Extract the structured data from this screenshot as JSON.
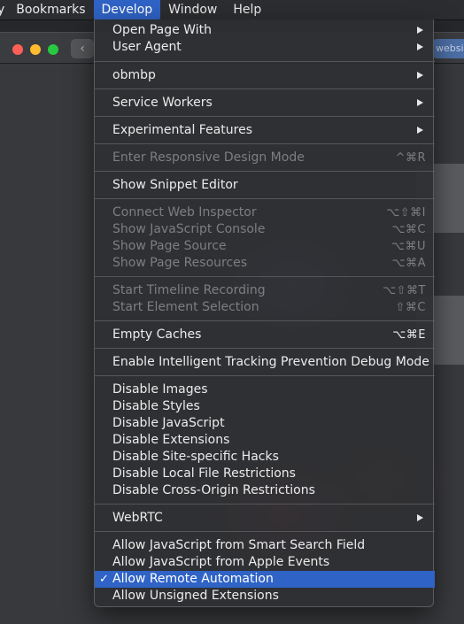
{
  "menubar": {
    "items": [
      "y",
      "Bookmarks",
      "Develop",
      "Window",
      "Help"
    ]
  },
  "window": {
    "back_icon": "chevron-left-icon",
    "url_peek": "websi"
  },
  "menu": {
    "items": [
      {
        "label": "Open Page With",
        "submenu": true
      },
      {
        "label": "User Agent",
        "submenu": true
      },
      {
        "label": "obmbp",
        "submenu": true
      },
      {
        "label": "Service Workers",
        "submenu": true
      },
      {
        "label": "Experimental Features",
        "submenu": true
      },
      {
        "label": "Enter Responsive Design Mode",
        "shortcut": "^⌘R",
        "disabled": true
      },
      {
        "label": "Show Snippet Editor"
      },
      {
        "label": "Connect Web Inspector",
        "shortcut": "⌥⇧⌘I",
        "disabled": true
      },
      {
        "label": "Show JavaScript Console",
        "shortcut": "⌥⌘C",
        "disabled": true
      },
      {
        "label": "Show Page Source",
        "shortcut": "⌥⌘U",
        "disabled": true
      },
      {
        "label": "Show Page Resources",
        "shortcut": "⌥⌘A",
        "disabled": true
      },
      {
        "label": "Start Timeline Recording",
        "shortcut": "⌥⇧⌘T",
        "disabled": true
      },
      {
        "label": "Start Element Selection",
        "shortcut": "⇧⌘C",
        "disabled": true
      },
      {
        "label": "Empty Caches",
        "shortcut": "⌥⌘E"
      },
      {
        "label": "Enable Intelligent Tracking Prevention Debug Mode"
      },
      {
        "label": "Disable Images"
      },
      {
        "label": "Disable Styles"
      },
      {
        "label": "Disable JavaScript"
      },
      {
        "label": "Disable Extensions"
      },
      {
        "label": "Disable Site-specific Hacks"
      },
      {
        "label": "Disable Local File Restrictions"
      },
      {
        "label": "Disable Cross-Origin Restrictions"
      },
      {
        "label": "WebRTC",
        "submenu": true
      },
      {
        "label": "Allow JavaScript from Smart Search Field"
      },
      {
        "label": "Allow JavaScript from Apple Events"
      },
      {
        "label": "Allow Remote Automation",
        "checked": true,
        "highlighted": true
      },
      {
        "label": "Allow Unsigned Extensions"
      }
    ],
    "check_mark": "✓",
    "highlight_color": "#2f63c6"
  }
}
